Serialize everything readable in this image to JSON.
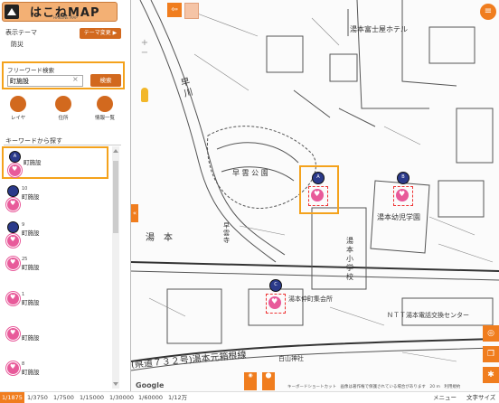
{
  "app": {
    "title": "はこねMAP",
    "subtitle": "HAKONE MAP"
  },
  "theme": {
    "label": "表示テーマ",
    "value": "防災",
    "change_button": "テーマ変更 ▶"
  },
  "search": {
    "label": "フリーワード検索",
    "value": "町施設",
    "button": "検索"
  },
  "tools": [
    {
      "label": "レイヤ",
      "icon": "list-icon"
    },
    {
      "label": "住所",
      "icon": "home-icon"
    },
    {
      "label": "情報一覧",
      "icon": "table-icon"
    }
  ],
  "keyword_label": "キーワードから探す",
  "results": [
    {
      "marker": "A",
      "num": "",
      "name": "町施設"
    },
    {
      "marker": "",
      "num": "10",
      "name": "町施設"
    },
    {
      "marker": "",
      "num": "9",
      "name": "町施設"
    },
    {
      "marker": "",
      "num": "25",
      "name": "町施設"
    },
    {
      "marker": "",
      "num": "1",
      "name": "町施設"
    },
    {
      "marker": "",
      "num": "",
      "name": "町施設"
    },
    {
      "marker": "",
      "num": "8",
      "name": "町施設"
    }
  ],
  "map": {
    "markers": [
      "A",
      "B",
      "C"
    ],
    "labels": {
      "hotel": "湯本富士屋ホテル",
      "park": "早 雲 公 園",
      "kindergarten": "湯本幼児学園",
      "temple": "早雲寺",
      "school": "湯本小学校",
      "yumoto": "湯　本",
      "assembly": "湯本仲町集会所",
      "ntt": "ＮＴＴ湯本電話交換センター",
      "road": "(県道７３２号)湯本元箱根線",
      "shrine": "白山神社",
      "river": "早川",
      "ridge": "寺"
    },
    "attribution": "キーボードショートカット　画像は著作権で保護されている場合があります　20 m　利用規約",
    "google": "Google"
  },
  "scales": [
    "1/1875",
    "1/3750",
    "1/7500",
    "1/15000",
    "1/30000",
    "1/60000",
    "1/12万"
  ],
  "bottom": {
    "menu": "メニュー",
    "font_size": "文字サイズ"
  },
  "colors": {
    "accent": "#f07d1e",
    "highlight": "#f4a21c",
    "marker": "#2b3a8a",
    "heart": "#e85a9a"
  }
}
